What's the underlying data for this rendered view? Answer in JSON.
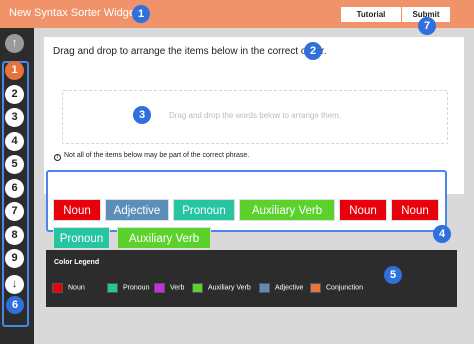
{
  "header": {
    "title": "New Syntax Sorter Widget",
    "tutorial_label": "Tutorial",
    "submit_label": "Submit"
  },
  "badges": [
    "1",
    "2",
    "3",
    "4",
    "5",
    "6",
    "7"
  ],
  "sidebar": {
    "up_arrow": "↑",
    "down_arrow": "↓",
    "questions": [
      "1",
      "2",
      "3",
      "4",
      "5",
      "6",
      "7",
      "8",
      "9"
    ],
    "active_question": "1"
  },
  "main": {
    "instruction": "Drag and drop to arrange the items below in the correct order.",
    "dropzone_placeholder": "Drag and drop the words below to arrange them.",
    "note_icon": "!",
    "note": "Not all of the items below may be part of the correct phrase."
  },
  "words": [
    {
      "label": "Noun",
      "color": "#e8000b"
    },
    {
      "label": "Adjective",
      "color": "#5b8fb9"
    },
    {
      "label": "Pronoun",
      "color": "#26c4a0"
    },
    {
      "label": "Auxiliary Verb",
      "color": "#5bd12b"
    },
    {
      "label": "Noun",
      "color": "#e8000b"
    },
    {
      "label": "Noun",
      "color": "#e8000b"
    },
    {
      "label": "Pronoun",
      "color": "#26c4a0"
    },
    {
      "label": "Auxiliary Verb",
      "color": "#5bd12b"
    }
  ],
  "legend": {
    "title": "Color Legend",
    "items": [
      {
        "label": "Noun",
        "color": "#e8000b"
      },
      {
        "label": "Pronoun",
        "color": "#26c4a0"
      },
      {
        "label": "Verb",
        "color": "#c82fe0"
      },
      {
        "label": "Auxiliary Verb",
        "color": "#5bd12b"
      },
      {
        "label": "Adjective",
        "color": "#5b8fb9"
      },
      {
        "label": "Conjunction",
        "color": "#e8743b"
      }
    ]
  },
  "colors": {
    "header": "#f0926a",
    "accent": "#2f6fde",
    "active_question": "#e8743b",
    "sidebar": "#2c2c2c"
  }
}
